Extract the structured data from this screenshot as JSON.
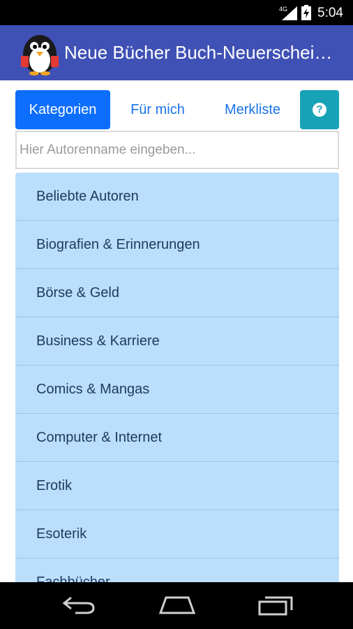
{
  "status_bar": {
    "network": "4G",
    "time": "5:04"
  },
  "app_bar": {
    "title": "Neue Bücher Buch-Neuerscheinungen",
    "logo_icon": "penguin-icon"
  },
  "tabs": [
    {
      "label": "Kategorien",
      "selected": true
    },
    {
      "label": "Für mich",
      "selected": false
    },
    {
      "label": "Merkliste",
      "selected": false
    }
  ],
  "help_button": {
    "label": "?"
  },
  "search": {
    "placeholder": "Hier Autorenname eingeben...",
    "value": ""
  },
  "categories": [
    "Beliebte Autoren",
    "Biografien & Erinnerungen",
    "Börse & Geld",
    "Business & Karriere",
    "Comics & Mangas",
    "Computer & Internet",
    "Erotik",
    "Esoterik",
    "Fachbücher"
  ],
  "nav_bar": {
    "back_icon": "back-icon",
    "home_icon": "home-icon",
    "recents_icon": "recents-icon"
  },
  "colors": {
    "app_bar": "#3f51b5",
    "tab_selected": "#0d6efd",
    "help": "#17a2b8",
    "list_item": "#bbdefb"
  }
}
